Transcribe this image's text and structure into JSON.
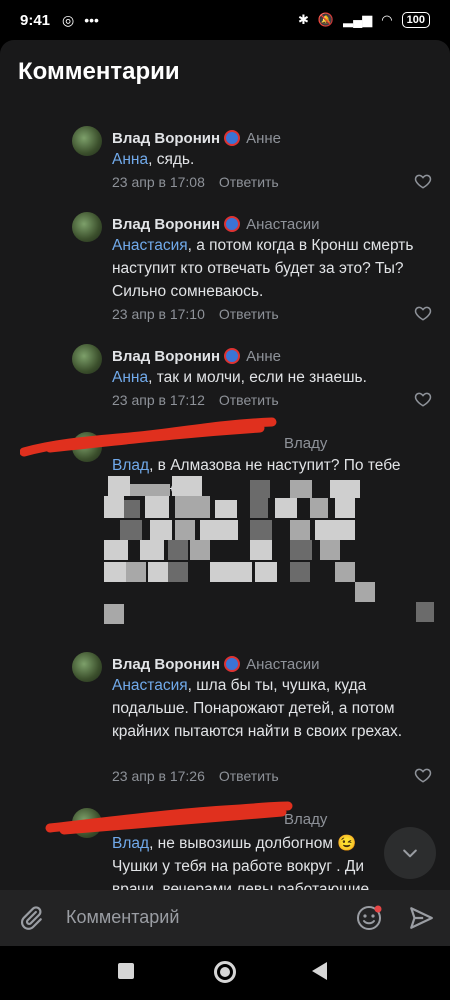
{
  "status_bar": {
    "time": "9:41",
    "battery": "100"
  },
  "header": {
    "title": "Комментарии"
  },
  "comments": [
    {
      "author": "Влад Воронин",
      "reply_to": "Анне",
      "mention": "Анна",
      "text": ", сядь.",
      "date": "23 апр в 17:08",
      "reply_label": "Ответить"
    },
    {
      "author": "Влад Воронин",
      "reply_to": "Анастасии",
      "mention": "Анастасия",
      "text": ", а потом когда в Кронш смерть наступит кто отвечать будет за это? Ты? Сильно сомневаюсь.",
      "date": "23 апр в 17:10",
      "reply_label": "Ответить"
    },
    {
      "author": "Влад Воронин",
      "reply_to": "Анне",
      "mention": "Анна",
      "text": ", так и молчи, если не знаешь.",
      "date": "23 апр в 17:12",
      "reply_label": "Ответить"
    },
    {
      "author": "",
      "reply_to": "Владу",
      "mention": "Влад",
      "text": ", в Алмазова не наступит? По тебе",
      "text_line2": "т та                               отают."
    },
    {
      "author": "Влад Воронин",
      "reply_to": "Анастасии",
      "mention": "Анастасия",
      "text": ", шла бы ты, чушка, куда подальше. Понарожают детей, а потом крайних пытаются найти в своих грехах.",
      "date": "23 апр в 17:26",
      "reply_label": "Ответить"
    },
    {
      "author": "",
      "reply_to": "Владу",
      "mention": "Влад",
      "text": ", не вывозишь долбогном 😉 Чушки у тебя на работе вокруг . Ди врачи, вечерами левы работающие"
    }
  ],
  "input": {
    "placeholder": "Комментарий"
  },
  "icons": {
    "heart": "heart-icon",
    "attach": "paperclip-icon",
    "sticker": "sticker-smile-icon",
    "send": "send-icon",
    "scroll_down": "chevron-down-icon"
  },
  "colors": {
    "background": "#19191a",
    "mention": "#71aaeb",
    "secondary_text": "#8e9299",
    "scribble": "#e0301e"
  }
}
